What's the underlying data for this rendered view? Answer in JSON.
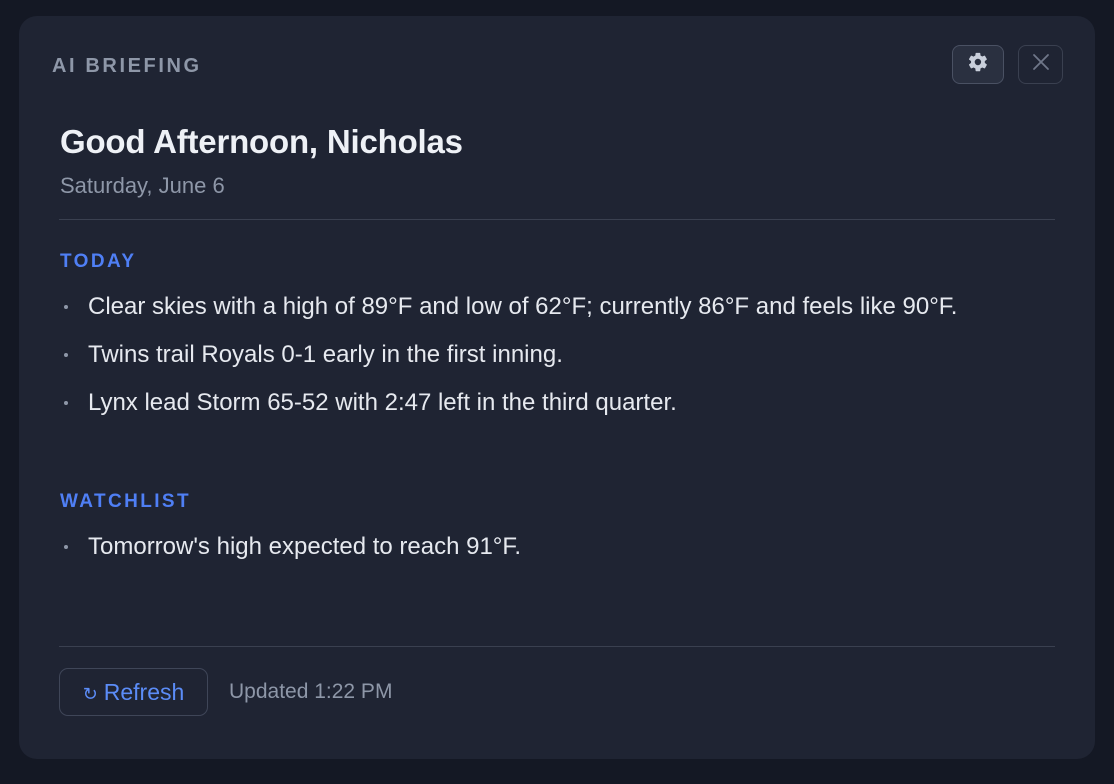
{
  "header": {
    "label": "AI BRIEFING",
    "settings_icon": "gear-icon",
    "close_icon": "close-icon"
  },
  "greeting": "Good Afternoon, Nicholas",
  "date": "Saturday, June 6",
  "sections": [
    {
      "title": "TODAY",
      "items": [
        "Clear skies with a high of 89°F and low of 62°F; currently 86°F and feels like 90°F.",
        "Twins trail Royals 0-1 early in the first inning.",
        "Lynx lead Storm 65-52 with 2:47 left in the third quarter."
      ]
    },
    {
      "title": "WATCHLIST",
      "items": [
        "Tomorrow's high expected to reach 91°F."
      ]
    }
  ],
  "footer": {
    "refresh_label": "Refresh",
    "refresh_icon": "refresh-icon",
    "updated_text": "Updated 1:22 PM"
  },
  "colors": {
    "background": "#141824",
    "card": "#1f2433",
    "accent": "#4f7ff5",
    "text": "#e6e9ef",
    "muted": "#8e97a8"
  }
}
